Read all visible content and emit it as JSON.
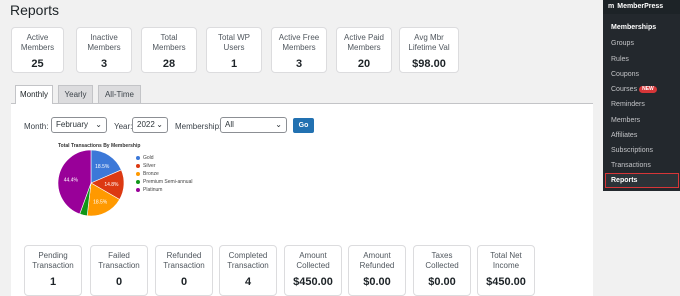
{
  "page": {
    "title": "Reports"
  },
  "stats_top": [
    {
      "label": "Active\nMembers",
      "value": "25"
    },
    {
      "label": "Inactive\nMembers",
      "value": "3"
    },
    {
      "label": "Total\nMembers",
      "value": "28"
    },
    {
      "label": "Total WP\nUsers",
      "value": "1"
    },
    {
      "label": "Active Free\nMembers",
      "value": "3"
    },
    {
      "label": "Active Paid\nMembers",
      "value": "20"
    },
    {
      "label": "Avg Mbr\nLifetime Val",
      "value": "$98.00"
    }
  ],
  "tabs": [
    {
      "label": "Monthly",
      "active": true
    },
    {
      "label": "Yearly",
      "active": false
    },
    {
      "label": "All-Time",
      "active": false
    }
  ],
  "filters": {
    "month_label": "Month:",
    "month_value": "February",
    "year_label": "Year:",
    "year_value": "2022",
    "membership_label": "Membership:",
    "membership_value": "All",
    "go_label": "Go"
  },
  "chart_data": {
    "type": "pie",
    "title": "Total Transactions By Membership",
    "categories": [
      "Gold",
      "Silver",
      "Bronze",
      "Premium Semi-annual",
      "Platinum"
    ],
    "values": [
      18.5,
      14.8,
      18.5,
      3.7,
      44.4
    ],
    "labels": [
      "18.5%",
      "14.8%",
      "18.5%",
      "",
      "44.4%"
    ],
    "colors": [
      "#3c78d8",
      "#dc3912",
      "#ff9900",
      "#109618",
      "#990099"
    ],
    "legend_position": "right"
  },
  "stats_bottom": [
    {
      "label": "Pending\nTransaction",
      "value": "1"
    },
    {
      "label": "Failed\nTransaction",
      "value": "0"
    },
    {
      "label": "Refunded\nTransaction",
      "value": "0"
    },
    {
      "label": "Completed\nTransaction",
      "value": "4"
    },
    {
      "label": "Amount\nCollected",
      "value": "$450.00"
    },
    {
      "label": "Amount\nRefunded",
      "value": "$0.00"
    },
    {
      "label": "Taxes\nCollected",
      "value": "$0.00"
    },
    {
      "label": "Total Net\nIncome",
      "value": "$450.00"
    }
  ],
  "sidebar": {
    "brand": "MemberPress",
    "logo": "m",
    "items": [
      "Memberships",
      "Groups",
      "Rules",
      "Coupons",
      "Courses",
      "Reminders",
      "Members",
      "Affiliates",
      "Subscriptions",
      "Transactions",
      "Reports"
    ],
    "new_badge": "NEW"
  }
}
